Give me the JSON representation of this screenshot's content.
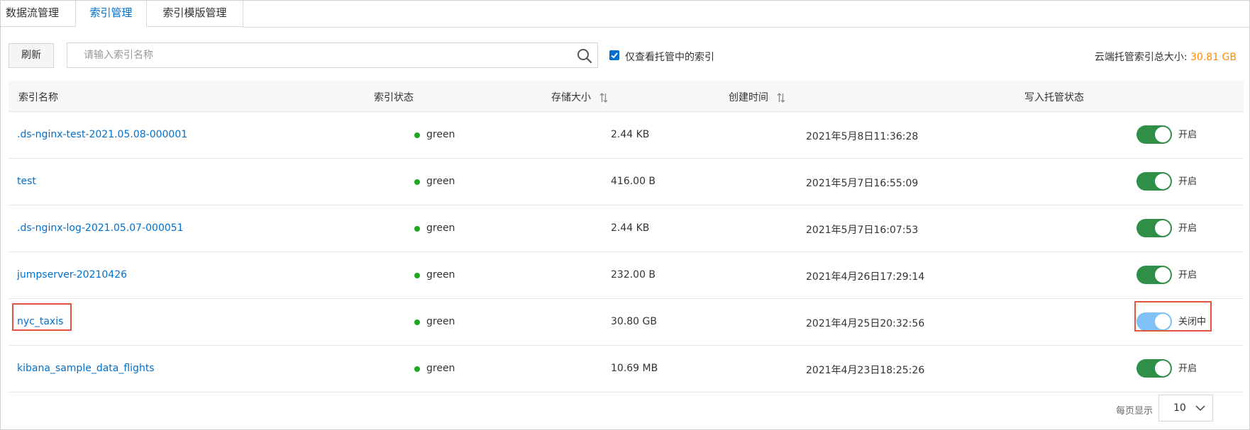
{
  "tabs": [
    {
      "label": "数据流管理",
      "active": false
    },
    {
      "label": "索引管理",
      "active": true
    },
    {
      "label": "索引模版管理",
      "active": false
    }
  ],
  "toolbar": {
    "refresh_label": "刷新",
    "search_placeholder": "请输入索引名称",
    "search_value": "",
    "checkbox_label": "仅查看托管中的索引",
    "checkbox_checked": true,
    "total_label": "云端托管索引总大小:",
    "total_value": "30.81 GB"
  },
  "table": {
    "headers": {
      "name": "索引名称",
      "status": "索引状态",
      "size": "存储大小",
      "created": "创建时间",
      "write": "写入托管状态"
    },
    "rows": [
      {
        "name": ".ds-nginx-test-2021.05.08-000001",
        "status": "green",
        "size": "2.44 KB",
        "created": "2021年5月8日11:36:28",
        "toggle_label": "开启",
        "toggle_state": "on"
      },
      {
        "name": "test",
        "status": "green",
        "size": "416.00 B",
        "created": "2021年5月7日16:55:09",
        "toggle_label": "开启",
        "toggle_state": "on"
      },
      {
        "name": ".ds-nginx-log-2021.05.07-000051",
        "status": "green",
        "size": "2.44 KB",
        "created": "2021年5月7日16:07:53",
        "toggle_label": "开启",
        "toggle_state": "on"
      },
      {
        "name": "jumpserver-20210426",
        "status": "green",
        "size": "232.00 B",
        "created": "2021年4月26日17:29:14",
        "toggle_label": "开启",
        "toggle_state": "on"
      },
      {
        "name": "nyc_taxis",
        "status": "green",
        "size": "30.80 GB",
        "created": "2021年4月25日20:32:56",
        "toggle_label": "关闭中",
        "toggle_state": "closing"
      },
      {
        "name": "kibana_sample_data_flights",
        "status": "green",
        "size": "10.69 MB",
        "created": "2021年4月23日18:25:26",
        "toggle_label": "开启",
        "toggle_state": "on"
      }
    ]
  },
  "pager": {
    "label": "每页显示",
    "page_size": "10"
  },
  "colors": {
    "link": "#0070cc",
    "status_green": "#1fa81f",
    "toggle_on": "#2f8f46",
    "toggle_closing": "#7fc0f7",
    "highlight": "#e3543e",
    "total_value": "#ff8a00"
  }
}
